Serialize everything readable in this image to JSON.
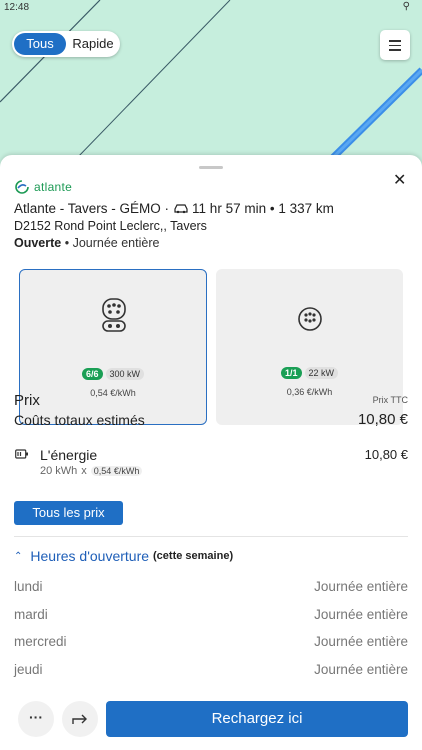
{
  "status_bar": {
    "time": "12:48",
    "location_icon": "location-pin-icon"
  },
  "filter": {
    "options": [
      "Tous",
      "Rapide"
    ],
    "selected": "Tous"
  },
  "menu_icon": "hamburger-menu-icon",
  "colors": {
    "primary": "#1f6fc5",
    "green": "#1a9f55",
    "map_bg": "#c6eedd",
    "road": "#3b8ee8"
  },
  "station": {
    "brand": "atlante",
    "title": "Atlante - Tavers - GÉMO",
    "drive_time": "11 hr 57 min",
    "distance": "1 337 km",
    "address": "D2152 Rond Point Leclerc,, Tavers",
    "status": "Ouverte",
    "hours_summary": "Journée entière"
  },
  "connectors": [
    {
      "icon": "ccs-connector-icon",
      "availability": "6/6",
      "power": "300 kW",
      "price": "0,54 €/kWh",
      "selected": true
    },
    {
      "icon": "type2-connector-icon",
      "availability": "1/1",
      "power": "22 kW",
      "price": "0,36 €/kWh",
      "selected": false
    }
  ],
  "pricing": {
    "heading": "Prix",
    "tax_note": "Prix TTC",
    "total_label": "Coûts totaux estimés",
    "total_value": "10,80 €",
    "energy_label": "L'énergie",
    "energy_value": "10,80 €",
    "energy_qty": "20 kWh",
    "energy_times": "x",
    "energy_rate": "0,54 €/kWh",
    "all_prices_button": "Tous les prix"
  },
  "hours": {
    "title": "Heures d'ouverture",
    "subtitle": "(cette semaine)",
    "rows": [
      {
        "day": "lundi",
        "value": "Journée entière"
      },
      {
        "day": "mardi",
        "value": "Journée entière"
      },
      {
        "day": "mercredi",
        "value": "Journée entière"
      },
      {
        "day": "jeudi",
        "value": "Journée entière"
      }
    ]
  },
  "actions": {
    "more": "···",
    "charge_button": "Rechargez ici"
  }
}
